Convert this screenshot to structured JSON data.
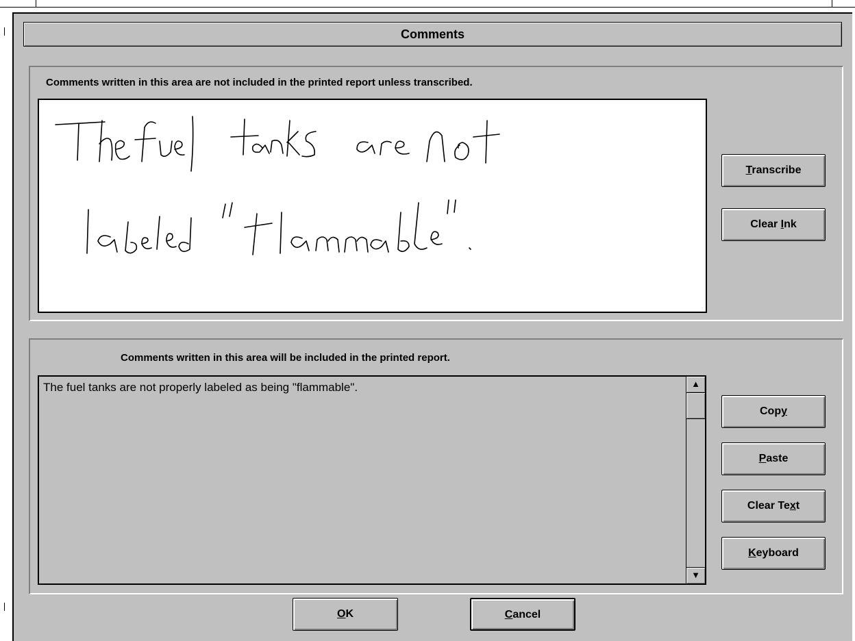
{
  "dialog": {
    "title": "Comments"
  },
  "ink_section": {
    "label": "Comments written in this area are not included in the printed report unless transcribed.",
    "handwriting": "The fuel tanks are not labeled \"flammable\"."
  },
  "text_section": {
    "label": "Comments written in this area will be included in the printed report.",
    "content": "The fuel tanks are not properly labeled as being \"flammable\"."
  },
  "buttons": {
    "transcribe": {
      "mnemonic": "T",
      "rest": "ranscribe"
    },
    "clear_ink": {
      "pre": "Clear ",
      "mnemonic": "I",
      "rest": "nk"
    },
    "copy": {
      "pre": "Cop",
      "mnemonic": "y",
      "rest": ""
    },
    "paste": {
      "mnemonic": "P",
      "rest": "aste"
    },
    "clear_text": {
      "pre": "Clear Te",
      "mnemonic": "x",
      "rest": "t"
    },
    "keyboard": {
      "mnemonic": "K",
      "rest": "eyboard"
    },
    "ok": {
      "mnemonic": "O",
      "rest": "K"
    },
    "cancel": {
      "mnemonic": "C",
      "rest": "ancel"
    }
  },
  "scrollbar": {
    "up_arrow": "▲",
    "down_arrow": "▼"
  }
}
